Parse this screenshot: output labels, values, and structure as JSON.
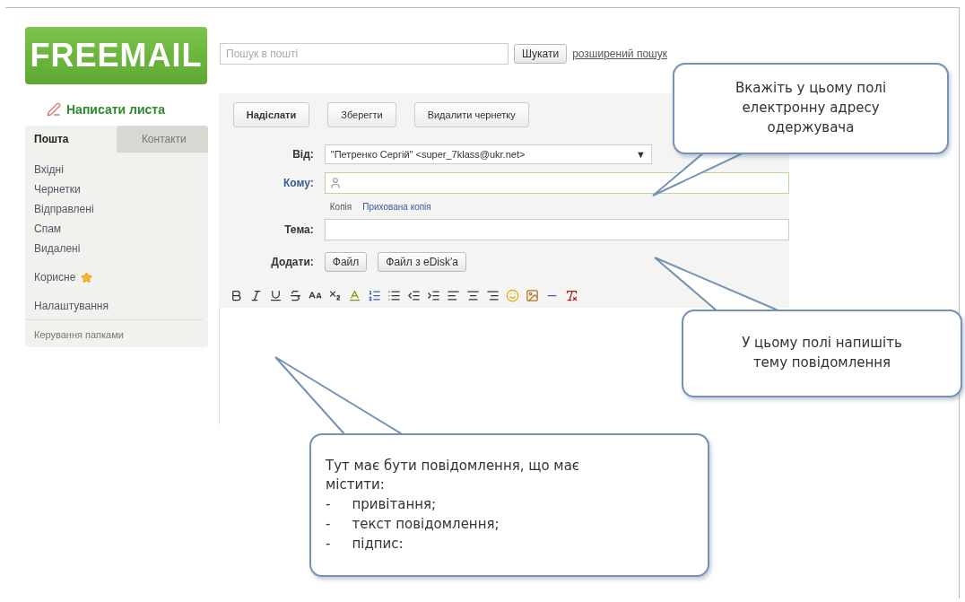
{
  "logo": "FREEMAIL",
  "search": {
    "placeholder": "Пошук в пошті",
    "button": "Шукати",
    "advanced_link": "розширений пошук"
  },
  "compose_link": "Написати листа",
  "sidebar": {
    "tabs": [
      {
        "label": "Пошта",
        "selected": true
      },
      {
        "label": "Контакти",
        "selected": false
      }
    ],
    "folders": [
      {
        "label": "Вхідні",
        "kind": "folder"
      },
      {
        "label": "Чернетки",
        "kind": "folder"
      },
      {
        "label": "Відправлені",
        "kind": "folder"
      },
      {
        "label": "Спам",
        "kind": "folder"
      },
      {
        "label": "Видалені",
        "kind": "folder"
      },
      {
        "label": "Корисне",
        "kind": "featured"
      },
      {
        "label": "Налаштування",
        "kind": "folder"
      }
    ],
    "footer_link": "Керування папками"
  },
  "toolbar": {
    "buttons": [
      "Надіслати",
      "Зберегти",
      "Видалити чернетку"
    ]
  },
  "form": {
    "from": {
      "label": "Від:",
      "value": "\"Петренко Сергій\" <super_7klass@ukr.net>",
      "arrow": "▼"
    },
    "to": {
      "label": "Кому:"
    },
    "cc_links": [
      "Копія",
      "Прихована копія"
    ],
    "subject": {
      "label": "Тема:"
    },
    "attach": {
      "label": "Додати:",
      "buttons": [
        "Файл",
        "Файл з eDisk'a"
      ]
    }
  },
  "callouts": [
    {
      "kind": "plain",
      "lines": [
        "Вкажіть у цьому полі",
        "електронну адресу",
        "одержувача"
      ]
    },
    {
      "kind": "plain",
      "lines": [
        "У цьому полі напишіть",
        "тему повідомлення"
      ]
    },
    {
      "kind": "list",
      "lines": [
        "Тут має бути повідомлення, що має",
        "містити:"
      ],
      "items": [
        {
          "marker": "-",
          "text": "привітання;"
        },
        {
          "marker": "-",
          "text": "текст повідомлення;"
        },
        {
          "marker": "-",
          "text": "підпис:"
        }
      ]
    }
  ]
}
